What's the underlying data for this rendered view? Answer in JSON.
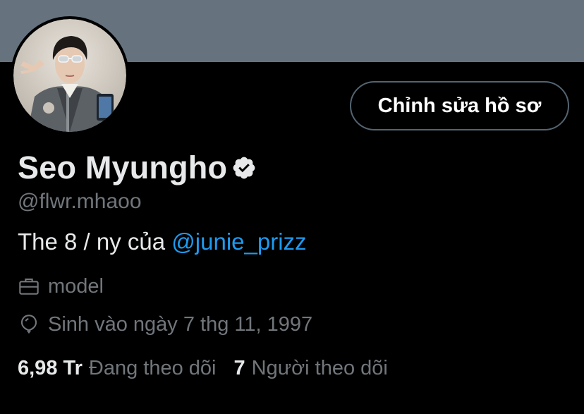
{
  "profile": {
    "display_name": "Seo Myungho",
    "handle": "@flwr.mhaoo",
    "bio_text": "The 8 / ny của ",
    "bio_mention": "@junie_prizz",
    "profession": "model",
    "birthdate": "Sinh vào ngày 7 thg 11, 1997",
    "verified": true
  },
  "actions": {
    "edit_profile_label": "Chỉnh sửa hồ sơ"
  },
  "stats": {
    "following_count": "6,98 Tr",
    "following_label": "Đang theo dõi",
    "followers_count": "7",
    "followers_label": "Người theo dõi"
  },
  "icons": {
    "verified": "verified-badge-icon",
    "profession": "briefcase-icon",
    "birthdate": "balloon-icon"
  },
  "colors": {
    "banner": "#66737f",
    "background": "#000000",
    "primary_text": "#e7e9ea",
    "secondary_text": "#71767b",
    "link": "#1d9bf0",
    "button_border": "#536471"
  }
}
